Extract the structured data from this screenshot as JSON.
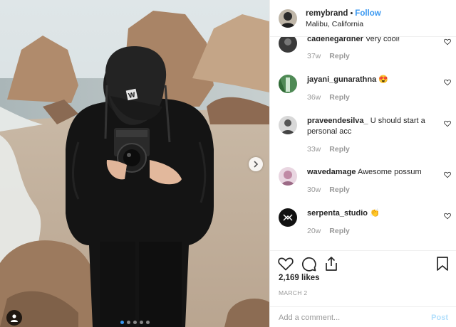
{
  "header": {
    "username": "remybrand",
    "separator": "•",
    "follow_label": "Follow",
    "location": "Malibu, California"
  },
  "comments": [
    {
      "user": "cadenegardner",
      "text": "Very cool!",
      "time": "37w",
      "reply": "Reply"
    },
    {
      "user": "jayani_gunarathna",
      "text": "😍",
      "time": "36w",
      "reply": "Reply"
    },
    {
      "user": "praveendesilva_",
      "text": "U should start a personal acc",
      "time": "33w",
      "reply": "Reply"
    },
    {
      "user": "wavedamage",
      "text": "Awesome possum",
      "time": "30w",
      "reply": "Reply"
    },
    {
      "user": "serpenta_studio",
      "text": "👏",
      "time": "20w",
      "reply": "Reply"
    }
  ],
  "actions": {
    "likes": "2,169 likes",
    "date": "MARCH 2",
    "comment_placeholder": "Add a comment...",
    "post_label": "Post"
  },
  "carousel": {
    "current": 1,
    "total": 5
  },
  "colors": {
    "link": "#3897f0",
    "muted": "#999999",
    "post_disabled": "#b2dffc"
  },
  "icons": [
    "heart-icon",
    "comment-icon",
    "share-icon",
    "bookmark-icon",
    "chevron-right-icon",
    "user-tag-icon"
  ]
}
